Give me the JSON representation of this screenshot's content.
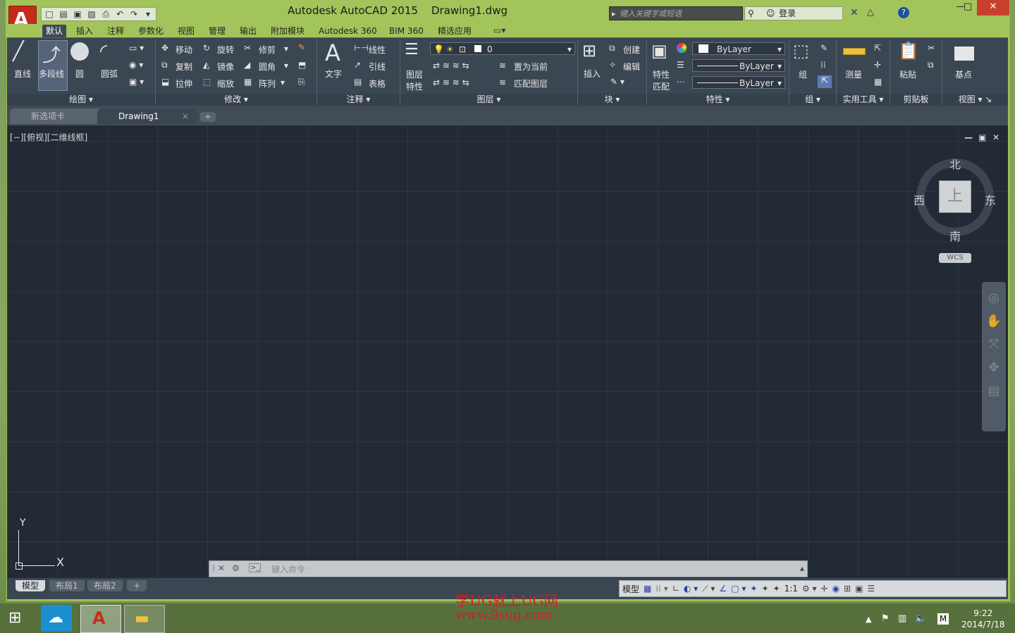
{
  "window": {
    "title": "Autodesk AutoCAD 2015",
    "document": "Drawing1.dwg",
    "app_glyph": "A",
    "search_placeholder": "键入关键字或短语",
    "login": "登录",
    "min": "—",
    "max": "□",
    "close": "✕",
    "help": "?"
  },
  "qat": {
    "new": "□",
    "open": "▤",
    "save": "▣",
    "saveas": "▧",
    "print": "⎙",
    "undo": "↶",
    "redo": "↷",
    "more": "▾"
  },
  "menu_tabs": [
    "默认",
    "插入",
    "注释",
    "参数化",
    "视图",
    "管理",
    "输出",
    "附加模块",
    "Autodesk 360",
    "BIM 360",
    "精选应用"
  ],
  "ribbon": {
    "draw": {
      "title": "绘图",
      "line": "直线",
      "polyline": "多段线",
      "circle": "圆",
      "arc": "圆弧"
    },
    "modify": {
      "title": "修改",
      "move": "移动",
      "rotate": "旋转",
      "trim": "修剪",
      "copy": "复制",
      "mirror": "镜像",
      "fillet": "圆角",
      "stretch": "拉伸",
      "scale": "缩放",
      "array": "阵列"
    },
    "annotation": {
      "title": "注释",
      "text": "文字",
      "linear": "线性",
      "leader": "引线",
      "table": "表格"
    },
    "layers": {
      "title": "图层",
      "props_line1": "图层",
      "props_line2": "特性",
      "layer_value": "0",
      "set_current": "置为当前",
      "match_layer": "匹配图层"
    },
    "block": {
      "title": "块",
      "insert": "插入",
      "create": "创建",
      "edit": "编辑"
    },
    "properties": {
      "title": "特性",
      "match_line1": "特性",
      "match_line2": "匹配",
      "color": "ByLayer",
      "linetype": "ByLayer",
      "lineweight": "ByLayer"
    },
    "groups": {
      "title": "组",
      "group": "组"
    },
    "utilities": {
      "title": "实用工具",
      "measure": "测量"
    },
    "clipboard": {
      "title": "剪贴板",
      "paste": "粘贴"
    },
    "view": {
      "title": "视图",
      "base": "基点"
    }
  },
  "file_tabs": {
    "start": "新选项卡",
    "drawing": "Drawing1",
    "close": "×",
    "add": "+"
  },
  "viewport": {
    "label": "[−][俯视][二维线框]",
    "min": "—",
    "restore": "▣",
    "close": "✕"
  },
  "viewcube": {
    "north": "北",
    "south": "南",
    "east": "东",
    "west": "西",
    "top": "上",
    "wcs": "WCS"
  },
  "ucs": {
    "x": "X",
    "y": "Y"
  },
  "command": {
    "placeholder": "键入命令",
    "close": "✕",
    "settings": "🔧",
    "prompt": ">_",
    "expand": "▴"
  },
  "layout_tabs": [
    "模型",
    "布局1",
    "布局2"
  ],
  "layout_add": "+",
  "status": {
    "model": "模型",
    "scale": "1:1"
  },
  "watermark": {
    "line1": "学UG就上UG网",
    "line2": "www.9sug.com"
  },
  "clock": {
    "time": "9:22",
    "date": "2014/7/18"
  },
  "tray_m": "M"
}
